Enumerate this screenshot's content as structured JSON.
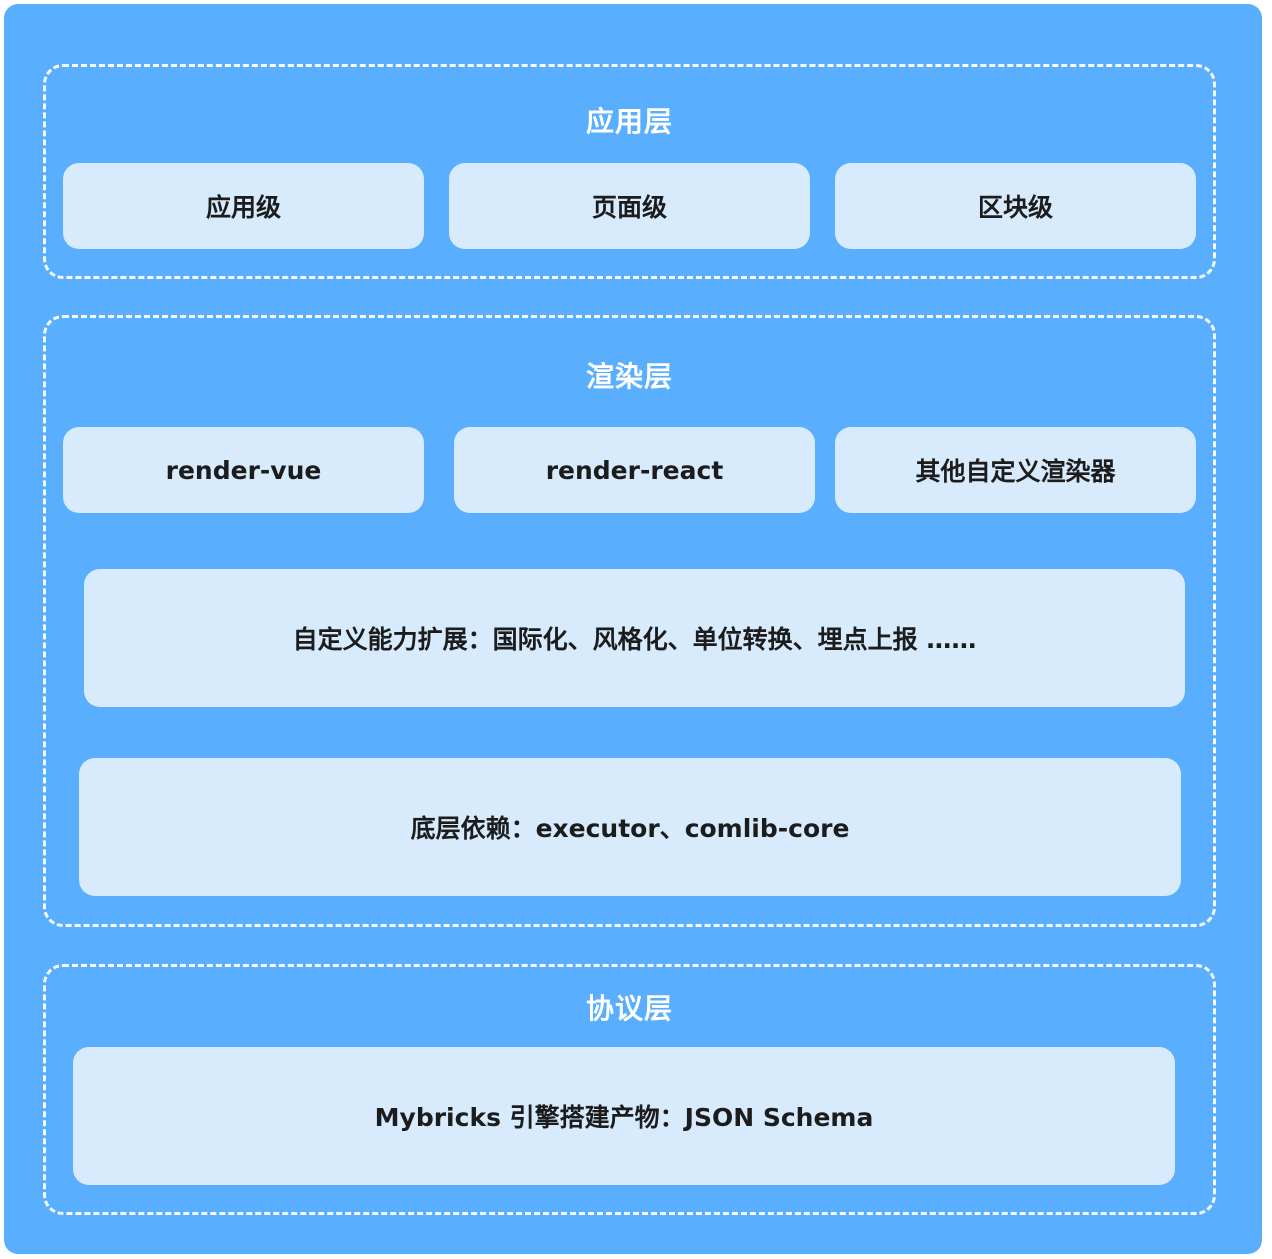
{
  "colors": {
    "background": "#5aaefe",
    "box_fill": "#d7ebfd",
    "title_text": "#ffffff",
    "box_text": "#1c1c1c"
  },
  "application_layer": {
    "title": "应用层",
    "items": [
      "应用级",
      "页面级",
      "区块级"
    ]
  },
  "render_layer": {
    "title": "渲染层",
    "renderers": [
      "render-vue",
      "render-react",
      "其他自定义渲染器"
    ],
    "extension": "自定义能力扩展：国际化、风格化、单位转换、埋点上报 ……",
    "dependency": "底层依赖：executor、comlib-core"
  },
  "protocol_layer": {
    "title": "协议层",
    "schema": "Mybricks 引擎搭建产物：JSON Schema"
  }
}
